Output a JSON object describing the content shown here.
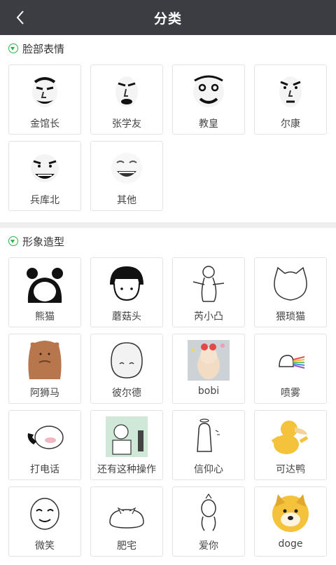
{
  "header": {
    "title": "分类"
  },
  "sections": [
    {
      "title": "脸部表情",
      "items": [
        "金馆长",
        "张学友",
        "教皇",
        "尔康",
        "兵库北",
        "其他"
      ]
    },
    {
      "title": "形象造型",
      "items": [
        "熊猫",
        "蘑菇头",
        "芮小凸",
        "猥琐猫",
        "阿狮马",
        "彼尔德",
        "bobi",
        "喷雾",
        "打电话",
        "还有这种操作",
        "信仰心",
        "可达鸭",
        "微笑",
        "肥宅",
        "爱你",
        "doge"
      ]
    }
  ],
  "colors": {
    "header_bg": "#3b3d43",
    "accent": "#2eb24a",
    "divider": "#eeeeee"
  }
}
